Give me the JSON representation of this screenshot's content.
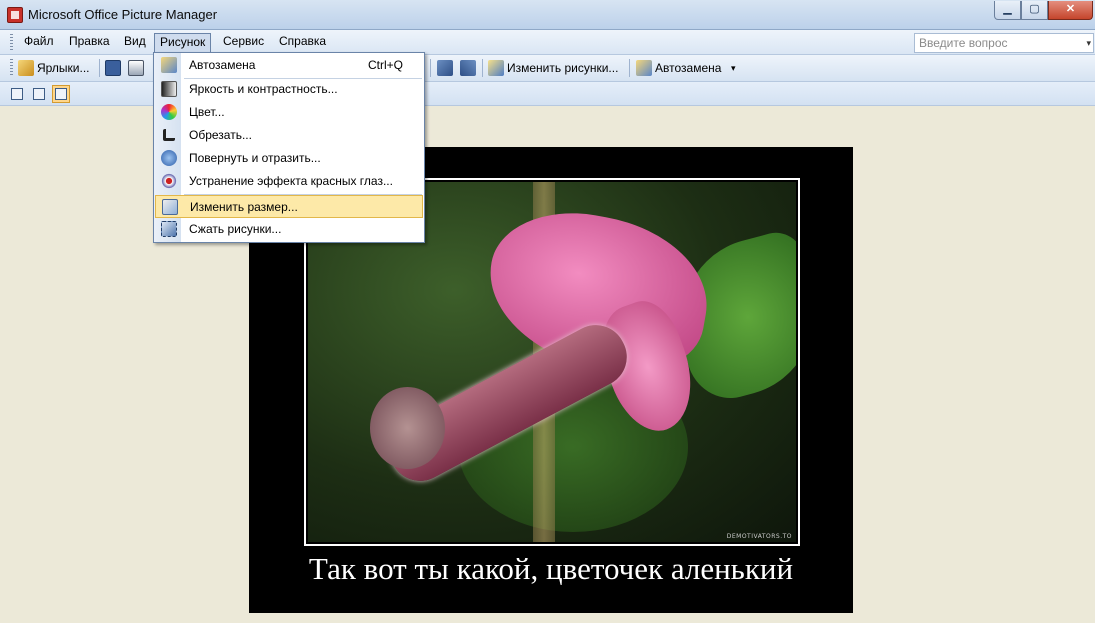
{
  "window": {
    "title": "Microsoft Office Picture Manager",
    "min_label": "▁",
    "max_label": "▢",
    "close_label": "✕"
  },
  "menubar": {
    "items": [
      {
        "label": "Файл"
      },
      {
        "label": "Правка"
      },
      {
        "label": "Вид"
      },
      {
        "label": "Рисунок"
      },
      {
        "label": "Сервис"
      },
      {
        "label": "Справка"
      }
    ],
    "ask_placeholder": "Введите вопрос",
    "ask_drop": "▾"
  },
  "toolbar": {
    "shortcuts_label": "Ярлыки...",
    "edit_pictures_label": "Изменить рисунки...",
    "autocorrect_label": "Автозамена",
    "overflow": "▾"
  },
  "picture_menu": {
    "items": [
      {
        "label": "Автозамена",
        "shortcut": "Ctrl+Q",
        "icon": "autocorrect-icon"
      },
      {
        "label": "Яркость и контрастность...",
        "icon": "brightness-icon"
      },
      {
        "label": "Цвет...",
        "icon": "color-icon"
      },
      {
        "label": "Обрезать...",
        "icon": "crop-icon"
      },
      {
        "label": "Повернуть и отразить...",
        "icon": "rotate-icon"
      },
      {
        "label": "Устранение эффекта красных глаз...",
        "icon": "red-eye-icon"
      },
      {
        "label": "Изменить размер...",
        "icon": "resize-icon"
      },
      {
        "label": "Сжать рисунки...",
        "icon": "compress-icon"
      }
    ],
    "highlighted": "Изменить размер..."
  },
  "image": {
    "caption": "Так вот ты какой, цветочек аленький",
    "watermark": "DEMOTIVATORS.TO"
  },
  "colors": {
    "accent": "#fde9a8",
    "menubar": "#dae6f4",
    "workspace": "#ece9d8"
  }
}
